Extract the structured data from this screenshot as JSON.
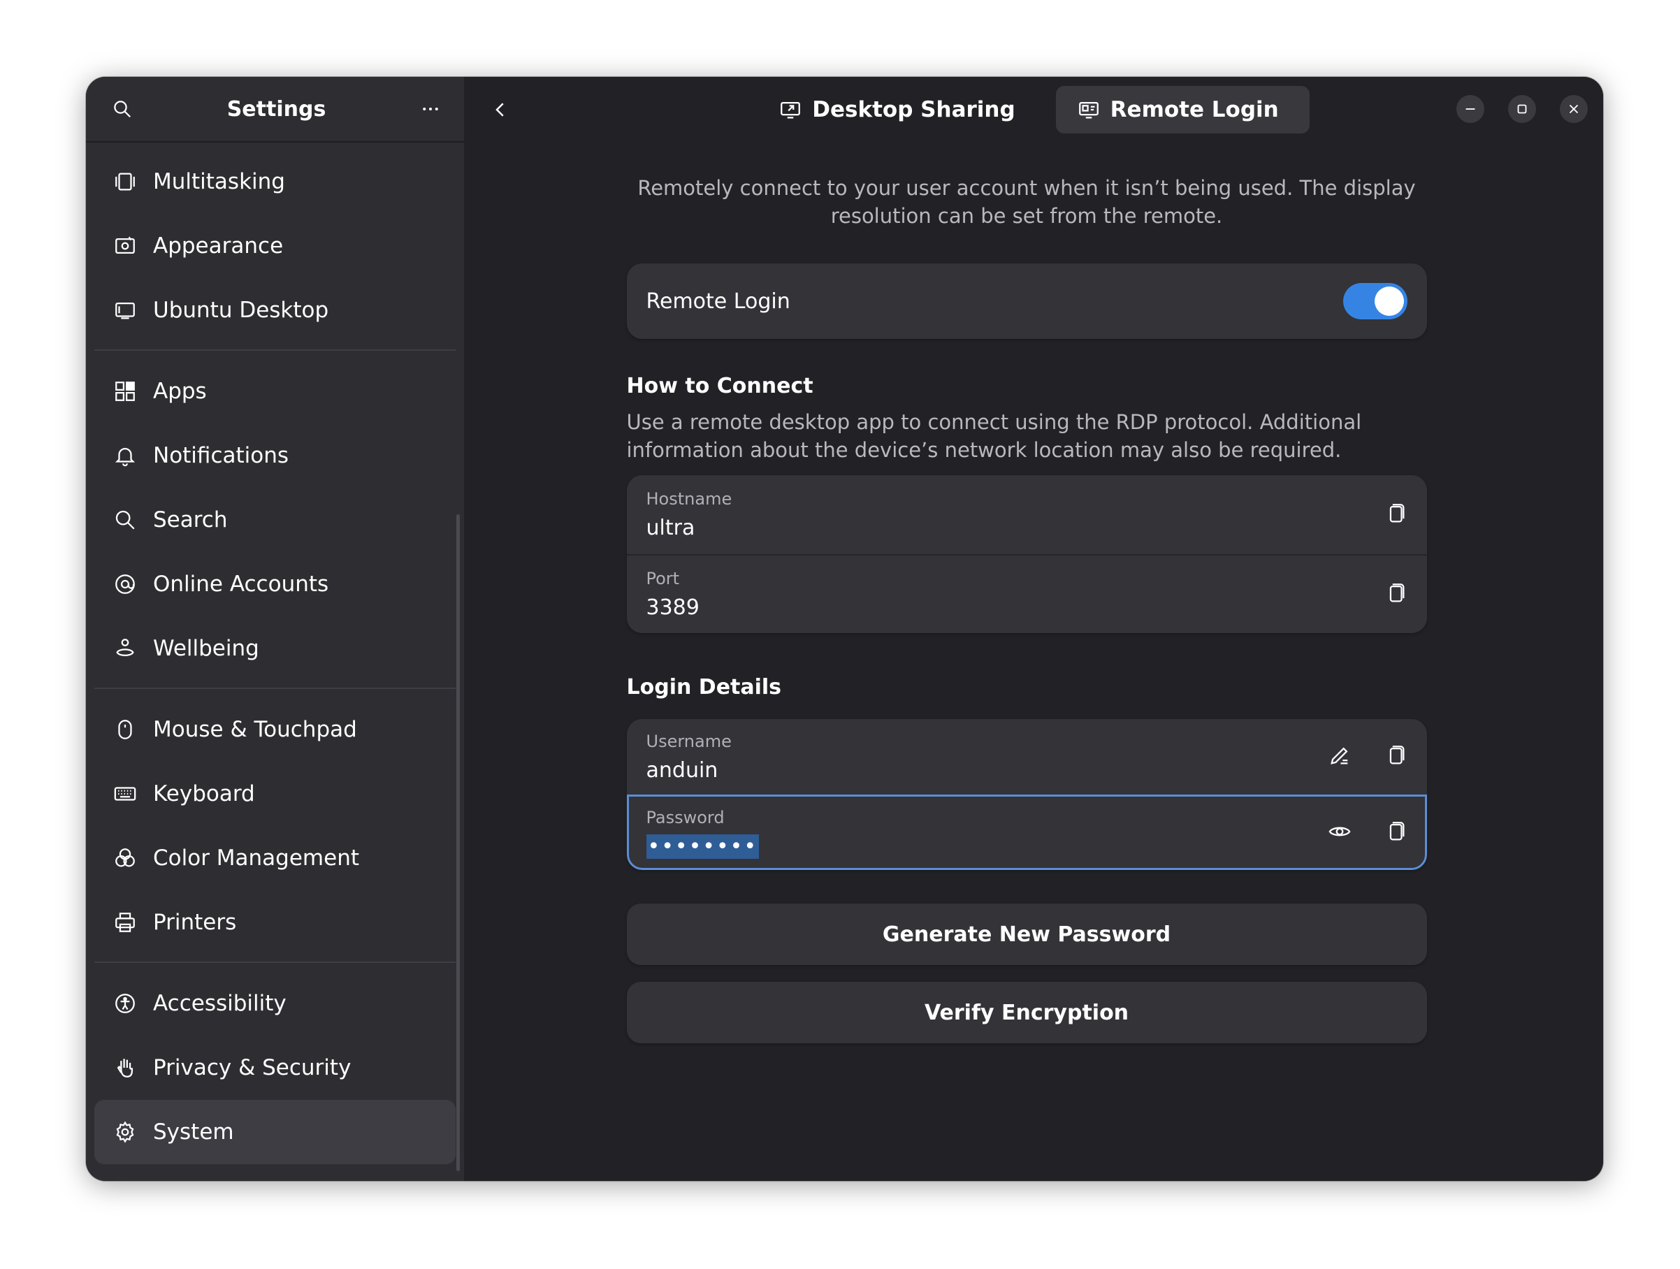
{
  "sidebar": {
    "title": "Settings",
    "groups": [
      [
        {
          "label": "Multitasking",
          "icon": "multitasking-icon"
        },
        {
          "label": "Appearance",
          "icon": "appearance-icon"
        },
        {
          "label": "Ubuntu Desktop",
          "icon": "ubuntu-desktop-icon"
        }
      ],
      [
        {
          "label": "Apps",
          "icon": "apps-icon"
        },
        {
          "label": "Notifications",
          "icon": "bell-icon"
        },
        {
          "label": "Search",
          "icon": "search-icon"
        },
        {
          "label": "Online Accounts",
          "icon": "at-icon"
        },
        {
          "label": "Wellbeing",
          "icon": "wellbeing-icon"
        }
      ],
      [
        {
          "label": "Mouse & Touchpad",
          "icon": "mouse-icon"
        },
        {
          "label": "Keyboard",
          "icon": "keyboard-icon"
        },
        {
          "label": "Color Management",
          "icon": "color-management-icon"
        },
        {
          "label": "Printers",
          "icon": "printer-icon"
        }
      ],
      [
        {
          "label": "Accessibility",
          "icon": "accessibility-icon"
        },
        {
          "label": "Privacy & Security",
          "icon": "hand-icon"
        },
        {
          "label": "System",
          "icon": "gear-icon",
          "active": true
        }
      ]
    ]
  },
  "header": {
    "tabs": [
      {
        "label": "Desktop Sharing",
        "icon": "desktop-sharing-icon",
        "active": false
      },
      {
        "label": "Remote Login",
        "icon": "remote-login-icon",
        "active": true
      }
    ]
  },
  "main": {
    "intro": "Remotely connect to your user account when it isn’t being used. The display resolution can be set from the remote.",
    "toggle": {
      "label": "Remote Login",
      "enabled": true
    },
    "how_to_connect": {
      "title": "How to Connect",
      "description": "Use a remote desktop app to connect using the RDP protocol. Additional information about the device’s network location may also be required.",
      "hostname_label": "Hostname",
      "hostname_value": "ultra",
      "port_label": "Port",
      "port_value": "3389"
    },
    "login_details": {
      "title": "Login Details",
      "username_label": "Username",
      "username_value": "anduin",
      "password_label": "Password",
      "password_value": "••••••••"
    },
    "buttons": {
      "generate": "Generate New Password",
      "verify": "Verify Encryption"
    }
  },
  "colors": {
    "accent": "#3584e4",
    "focus": "#5b8ed6"
  }
}
